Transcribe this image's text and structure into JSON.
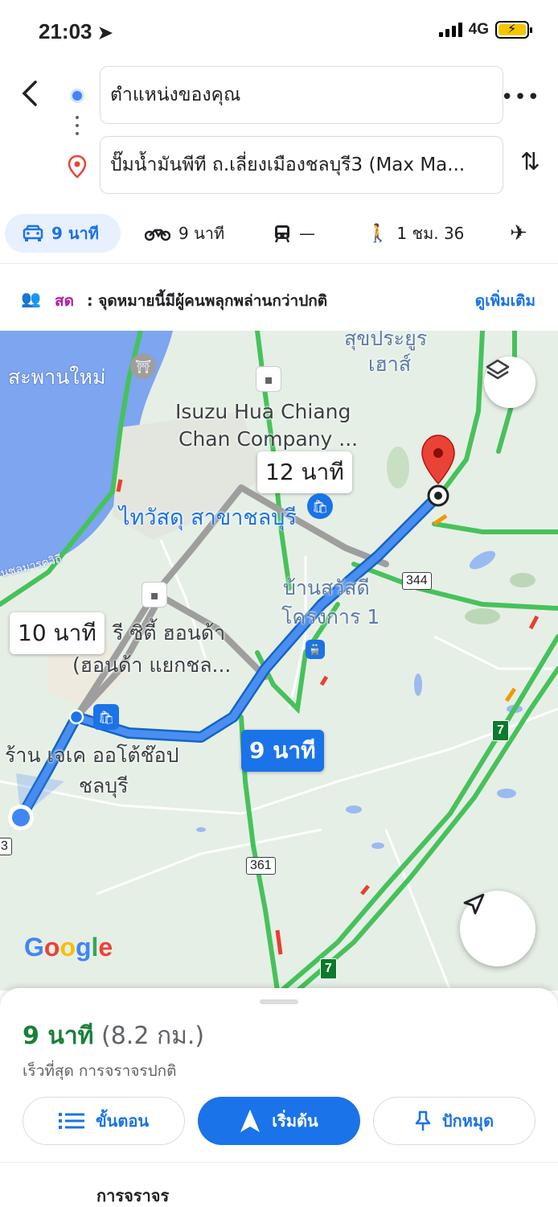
{
  "status": {
    "time": "21:03",
    "network": "4G"
  },
  "search": {
    "origin": "ตำแหน่งของคุณ",
    "destination": "ปั๊มน้ำมันพีที ถ.เลี่ยงเมืองชลบุรี3 (Max Ma..."
  },
  "modes": [
    {
      "icon": "car-icon",
      "label": "9 นาที",
      "active": true
    },
    {
      "icon": "motorcycle-icon",
      "label": "9 นาที",
      "active": false
    },
    {
      "icon": "transit-icon",
      "label": "—",
      "active": false
    },
    {
      "icon": "walk-icon",
      "label": "1 ชม. 36",
      "active": false
    },
    {
      "icon": "flight-icon",
      "label": "",
      "active": false
    }
  ],
  "live": {
    "label": "สด",
    "text": ": จุดหมายนี้มีผู้คนพลุกพล่านกว่าปกติ",
    "more": "ดูเพิ่มเติม"
  },
  "map": {
    "labels": {
      "bridge": "สะพานใหม่",
      "road": "นชลมารควิถี",
      "isuzu_1": "Isuzu Hua Chiang",
      "isuzu_2": "Chan Company ...",
      "thaiwatsadu": "ไทวัสดุ สาขาชลบุรี",
      "sukhprasert_1": "สุขประยูร",
      "sukhprasert_2": "เฮาส์",
      "village_1": "บ้านสวัสดี",
      "village_2": "โครงการ 1",
      "honda_1": "รี ซิตี้ ฮอนด้า",
      "honda_2": "(ฮอนด้า แยกชล...",
      "shop_1": "ร้าน เจเค ออโต้ช๊อป",
      "shop_2": "ชลบุรี"
    },
    "route_bubbles": {
      "alt_1": "12 นาที",
      "alt_2": "10 นาที",
      "main": "9 นาที"
    },
    "shields": {
      "hw344": "344",
      "hw361": "361",
      "left_edge": "3",
      "seven_1": "7",
      "seven_2": "7"
    },
    "google": "Google"
  },
  "sheet": {
    "eta": "9 นาที",
    "distance": "(8.2 กม.)",
    "description": "เร็วที่สุด การจราจรปกติ",
    "steps_label": "ขั้นตอน",
    "start_label": "เริ่มต้น",
    "pin_label": "ปักหมุด",
    "traffic_label": "การจราจร"
  },
  "colors": {
    "accent": "#1a73e8",
    "eta_green": "#188038",
    "live_magenta": "#b31aa0",
    "dest_red": "#ea4335"
  }
}
